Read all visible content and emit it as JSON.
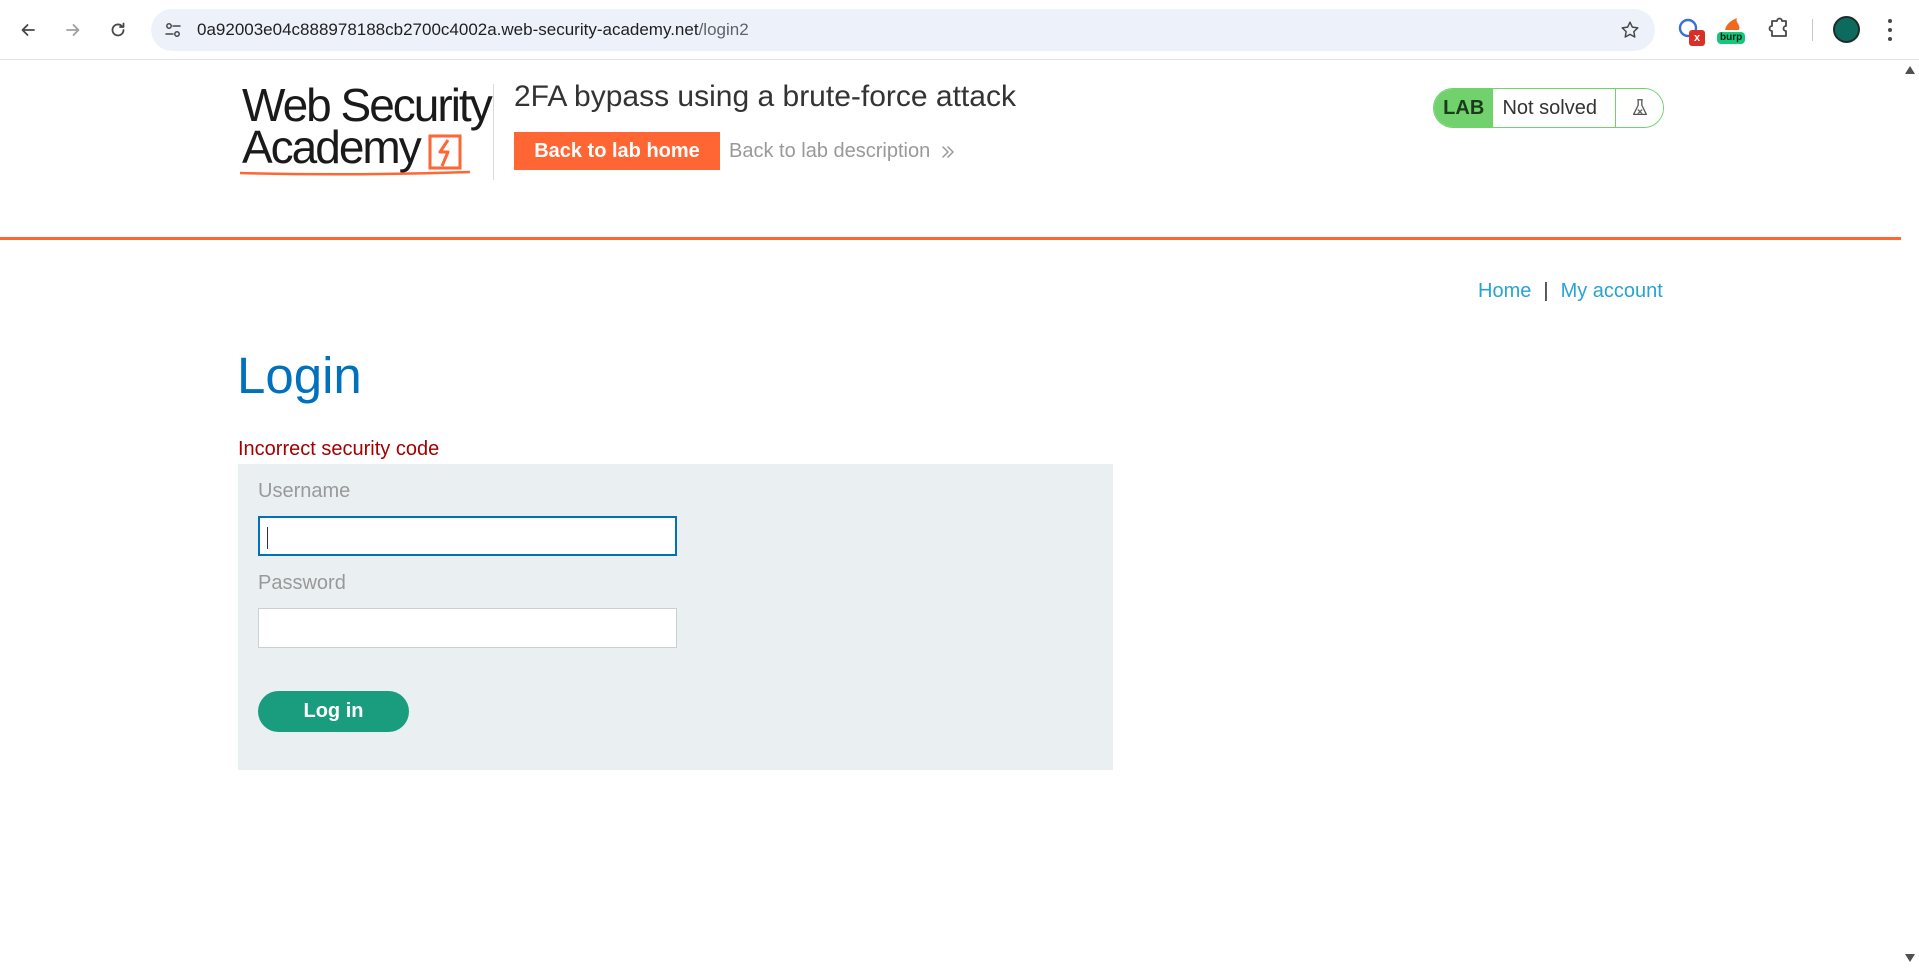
{
  "browser": {
    "url_host": "0a92003e04c888978188cb2700c4002a.web-security-academy.net",
    "url_path": "/login2",
    "extensions": [
      {
        "name": "ext-with-x-badge",
        "badge": "x"
      },
      {
        "name": "burp-extension",
        "badge": "burp"
      }
    ]
  },
  "header": {
    "logo_line1": "Web Security",
    "logo_line2": "Academy",
    "lab_title": "2FA bypass using a brute-force attack",
    "back_home_label": "Back to lab home",
    "back_description_label": "Back to lab description",
    "lab_badge": "LAB",
    "lab_status": "Not solved"
  },
  "nav": {
    "home_label": "Home",
    "separator": "|",
    "account_label": "My account"
  },
  "main": {
    "title": "Login",
    "error": "Incorrect security code",
    "form": {
      "username_label": "Username",
      "username_value": "",
      "password_label": "Password",
      "password_value": "",
      "submit_label": "Log in"
    }
  },
  "colors": {
    "accent_orange": "#ff6633",
    "title_blue": "#0071bc",
    "link_blue": "#29a3d4",
    "error_red": "#a50000",
    "login_green": "#1a9c7f",
    "lab_green": "#70d16d"
  }
}
